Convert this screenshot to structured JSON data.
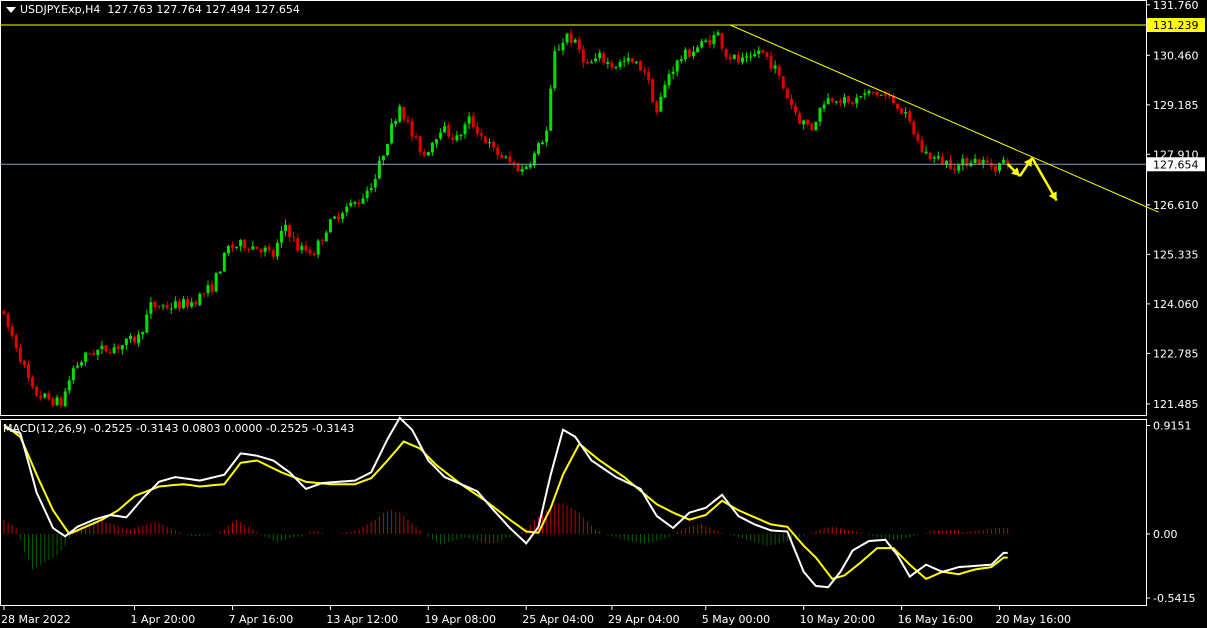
{
  "header": {
    "symbol": "USDJPY.Exp,H4",
    "open": "127.763",
    "high": "127.764",
    "low": "127.494",
    "close": "127.654"
  },
  "macd_header": {
    "name": "MACD(12,26,9)",
    "values": "-0.2525 -0.3143 0.0803 0.0000 -0.2525 -0.3143"
  },
  "colors": {
    "background": "#000000",
    "bull": "#00e000",
    "bear": "#e00000",
    "trendline": "#ffff00",
    "hline_yellow": "#ffff00",
    "hline_price": "#8a9bb8",
    "macd_line": "#ffffff",
    "signal_line": "#ffff00",
    "hist_pos": "#c00000",
    "hist_neg": "#006000",
    "arrow": "#ffff00",
    "label_yellow_bg": "#ffff00",
    "label_price_bg": "#ffffff"
  },
  "chart_data": [
    {
      "type": "candlestick",
      "title": "USDJPY.Exp,H4",
      "y_ticks": [
        "131.760",
        "130.460",
        "129.185",
        "127.910",
        "126.610",
        "125.335",
        "124.060",
        "122.785",
        "121.485"
      ],
      "ylim": [
        121.2,
        131.78
      ],
      "x_ticks": [
        "28 Mar 2022",
        "1 Apr 20:00",
        "7 Apr 16:00",
        "13 Apr 12:00",
        "19 Apr 08:00",
        "25 Apr 04:00",
        "29 Apr 04:00",
        "5 May 00:00",
        "10 May 20:00",
        "16 May 16:00",
        "20 May 16:00"
      ],
      "x_tick_index": [
        0,
        32,
        56,
        80,
        104,
        128,
        149,
        172,
        196,
        220,
        244
      ],
      "price_path": [
        [
          0,
          123.9
        ],
        [
          4,
          123.0
        ],
        [
          8,
          121.8
        ],
        [
          12,
          121.6
        ],
        [
          15,
          121.5
        ],
        [
          18,
          122.4
        ],
        [
          22,
          122.8
        ],
        [
          26,
          122.9
        ],
        [
          30,
          123.0
        ],
        [
          34,
          123.2
        ],
        [
          37,
          124.0
        ],
        [
          42,
          124.0
        ],
        [
          47,
          124.1
        ],
        [
          52,
          124.5
        ],
        [
          56,
          125.5
        ],
        [
          60,
          125.6
        ],
        [
          64,
          125.5
        ],
        [
          67,
          125.3
        ],
        [
          70,
          126.1
        ],
        [
          73,
          125.5
        ],
        [
          77,
          125.4
        ],
        [
          80,
          126.0
        ],
        [
          84,
          126.5
        ],
        [
          88,
          126.7
        ],
        [
          92,
          127.3
        ],
        [
          95,
          128.3
        ],
        [
          98,
          129.2
        ],
        [
          101,
          128.4
        ],
        [
          104,
          127.9
        ],
        [
          108,
          128.6
        ],
        [
          112,
          128.3
        ],
        [
          115,
          128.8
        ],
        [
          118,
          128.4
        ],
        [
          121,
          128.0
        ],
        [
          125,
          127.7
        ],
        [
          128,
          127.5
        ],
        [
          131,
          127.9
        ],
        [
          134,
          128.5
        ],
        [
          136,
          130.5
        ],
        [
          139,
          131.0
        ],
        [
          142,
          130.6
        ],
        [
          144,
          130.2
        ],
        [
          147,
          130.4
        ],
        [
          150,
          130.2
        ],
        [
          154,
          130.3
        ],
        [
          158,
          130.1
        ],
        [
          161,
          129.0
        ],
        [
          164,
          130.0
        ],
        [
          167,
          130.4
        ],
        [
          170,
          130.6
        ],
        [
          173,
          130.8
        ],
        [
          176,
          131.0
        ],
        [
          178,
          130.5
        ],
        [
          181,
          130.3
        ],
        [
          184,
          130.3
        ],
        [
          186,
          130.6
        ],
        [
          188,
          130.4
        ],
        [
          190,
          130.1
        ],
        [
          193,
          129.4
        ],
        [
          196,
          128.8
        ],
        [
          199,
          128.6
        ],
        [
          202,
          129.3
        ],
        [
          205,
          129.4
        ],
        [
          208,
          129.2
        ],
        [
          211,
          129.4
        ],
        [
          214,
          129.5
        ],
        [
          217,
          129.4
        ],
        [
          220,
          129.2
        ],
        [
          223,
          128.7
        ],
        [
          226,
          128.0
        ],
        [
          229,
          127.8
        ],
        [
          232,
          127.7
        ],
        [
          235,
          127.6
        ],
        [
          238,
          127.8
        ],
        [
          241,
          127.7
        ],
        [
          244,
          127.6
        ],
        [
          246,
          127.7
        ]
      ],
      "yellow_hline": 131.239,
      "price_hline": 127.654,
      "trendline": {
        "from": [
          178,
          131.239
        ],
        "to": [
          283,
          126.42
        ]
      },
      "price_labels": {
        "yellow": "131.239",
        "current": "127.654"
      },
      "projection_arrows": [
        [
          246,
          127.66
        ],
        [
          249,
          127.35
        ],
        [
          252,
          127.82
        ],
        [
          258,
          126.72
        ]
      ]
    },
    {
      "type": "macd",
      "title": "MACD(12,26,9)",
      "y_ticks": [
        "0.9151",
        "0.00",
        "-0.5415"
      ],
      "ylim": [
        -0.6,
        0.97
      ],
      "macd_path": [
        [
          0,
          0.9
        ],
        [
          4,
          0.85
        ],
        [
          8,
          0.35
        ],
        [
          12,
          0.05
        ],
        [
          15,
          -0.02
        ],
        [
          18,
          0.06
        ],
        [
          22,
          0.12
        ],
        [
          26,
          0.16
        ],
        [
          30,
          0.14
        ],
        [
          34,
          0.3
        ],
        [
          38,
          0.44
        ],
        [
          42,
          0.48
        ],
        [
          48,
          0.45
        ],
        [
          54,
          0.5
        ],
        [
          58,
          0.68
        ],
        [
          62,
          0.66
        ],
        [
          66,
          0.62
        ],
        [
          70,
          0.52
        ],
        [
          74,
          0.38
        ],
        [
          78,
          0.43
        ],
        [
          82,
          0.44
        ],
        [
          86,
          0.45
        ],
        [
          90,
          0.52
        ],
        [
          94,
          0.8
        ],
        [
          97,
          0.98
        ],
        [
          100,
          0.88
        ],
        [
          104,
          0.62
        ],
        [
          108,
          0.48
        ],
        [
          112,
          0.42
        ],
        [
          116,
          0.36
        ],
        [
          120,
          0.2
        ],
        [
          124,
          0.05
        ],
        [
          128,
          -0.08
        ],
        [
          131,
          0.06
        ],
        [
          134,
          0.5
        ],
        [
          137,
          0.88
        ],
        [
          140,
          0.82
        ],
        [
          144,
          0.62
        ],
        [
          150,
          0.48
        ],
        [
          156,
          0.38
        ],
        [
          160,
          0.15
        ],
        [
          164,
          0.05
        ],
        [
          168,
          0.18
        ],
        [
          172,
          0.22
        ],
        [
          176,
          0.33
        ],
        [
          180,
          0.15
        ],
        [
          184,
          0.08
        ],
        [
          188,
          0.03
        ],
        [
          192,
          0.02
        ],
        [
          196,
          -0.32
        ],
        [
          199,
          -0.44
        ],
        [
          202,
          -0.45
        ],
        [
          205,
          -0.32
        ],
        [
          208,
          -0.14
        ],
        [
          212,
          -0.06
        ],
        [
          216,
          -0.05
        ],
        [
          219,
          -0.18
        ],
        [
          222,
          -0.36
        ],
        [
          226,
          -0.26
        ],
        [
          230,
          -0.32
        ],
        [
          234,
          -0.28
        ],
        [
          238,
          -0.27
        ],
        [
          242,
          -0.26
        ],
        [
          245,
          -0.16
        ]
      ],
      "signal_path": [
        [
          0,
          0.92
        ],
        [
          4,
          0.82
        ],
        [
          8,
          0.5
        ],
        [
          12,
          0.2
        ],
        [
          16,
          0.0
        ],
        [
          20,
          0.06
        ],
        [
          24,
          0.12
        ],
        [
          28,
          0.2
        ],
        [
          32,
          0.32
        ],
        [
          38,
          0.4
        ],
        [
          44,
          0.42
        ],
        [
          48,
          0.4
        ],
        [
          54,
          0.42
        ],
        [
          58,
          0.6
        ],
        [
          62,
          0.62
        ],
        [
          68,
          0.52
        ],
        [
          74,
          0.44
        ],
        [
          80,
          0.42
        ],
        [
          86,
          0.42
        ],
        [
          90,
          0.47
        ],
        [
          94,
          0.62
        ],
        [
          98,
          0.78
        ],
        [
          102,
          0.72
        ],
        [
          106,
          0.58
        ],
        [
          112,
          0.42
        ],
        [
          118,
          0.28
        ],
        [
          124,
          0.12
        ],
        [
          128,
          0.02
        ],
        [
          131,
          0.01
        ],
        [
          134,
          0.22
        ],
        [
          137,
          0.5
        ],
        [
          141,
          0.76
        ],
        [
          146,
          0.62
        ],
        [
          152,
          0.48
        ],
        [
          160,
          0.25
        ],
        [
          164,
          0.18
        ],
        [
          168,
          0.12
        ],
        [
          172,
          0.16
        ],
        [
          176,
          0.28
        ],
        [
          180,
          0.2
        ],
        [
          184,
          0.14
        ],
        [
          188,
          0.08
        ],
        [
          192,
          0.06
        ],
        [
          196,
          -0.1
        ],
        [
          199,
          -0.2
        ],
        [
          203,
          -0.38
        ],
        [
          206,
          -0.35
        ],
        [
          210,
          -0.24
        ],
        [
          214,
          -0.12
        ],
        [
          218,
          -0.12
        ],
        [
          222,
          -0.26
        ],
        [
          226,
          -0.38
        ],
        [
          230,
          -0.32
        ],
        [
          234,
          -0.34
        ],
        [
          238,
          -0.3
        ],
        [
          242,
          -0.28
        ],
        [
          245,
          -0.2
        ]
      ],
      "histogram_path": [
        [
          0,
          0.12
        ],
        [
          3,
          0.05
        ],
        [
          5,
          -0.15
        ],
        [
          7,
          -0.3
        ],
        [
          9,
          -0.26
        ],
        [
          11,
          -0.22
        ],
        [
          13,
          -0.18
        ],
        [
          15,
          -0.1
        ],
        [
          17,
          0.02
        ],
        [
          19,
          0.06
        ],
        [
          21,
          0.1
        ],
        [
          23,
          0.12
        ],
        [
          25,
          0.1
        ],
        [
          27,
          0.08
        ],
        [
          29,
          0.05
        ],
        [
          31,
          0.04
        ],
        [
          33,
          0.06
        ],
        [
          35,
          0.08
        ],
        [
          37,
          0.1
        ],
        [
          38,
          0.09
        ],
        [
          40,
          0.06
        ],
        [
          42,
          0.03
        ],
        [
          44,
          0.0
        ],
        [
          46,
          -0.02
        ],
        [
          48,
          -0.02
        ],
        [
          50,
          -0.01
        ],
        [
          52,
          0.0
        ],
        [
          54,
          0.04
        ],
        [
          56,
          0.1
        ],
        [
          57,
          0.12
        ],
        [
          59,
          0.08
        ],
        [
          61,
          0.04
        ],
        [
          63,
          -0.01
        ],
        [
          65,
          -0.04
        ],
        [
          67,
          -0.07
        ],
        [
          69,
          -0.05
        ],
        [
          71,
          -0.03
        ],
        [
          73,
          -0.02
        ],
        [
          75,
          0.02
        ],
        [
          77,
          0.02
        ],
        [
          79,
          0.0
        ],
        [
          81,
          0.0
        ],
        [
          83,
          0.01
        ],
        [
          85,
          0.02
        ],
        [
          87,
          0.04
        ],
        [
          89,
          0.08
        ],
        [
          91,
          0.12
        ],
        [
          93,
          0.18
        ],
        [
          95,
          0.2
        ],
        [
          97,
          0.18
        ],
        [
          99,
          0.12
        ],
        [
          101,
          0.06
        ],
        [
          103,
          0.0
        ],
        [
          105,
          -0.05
        ],
        [
          107,
          -0.09
        ],
        [
          109,
          -0.07
        ],
        [
          111,
          -0.05
        ],
        [
          113,
          -0.03
        ],
        [
          115,
          -0.05
        ],
        [
          117,
          -0.07
        ],
        [
          119,
          -0.08
        ],
        [
          121,
          -0.07
        ],
        [
          123,
          -0.04
        ],
        [
          125,
          -0.02
        ],
        [
          127,
          0.02
        ],
        [
          129,
          0.08
        ],
        [
          131,
          0.14
        ],
        [
          133,
          0.2
        ],
        [
          135,
          0.25
        ],
        [
          137,
          0.26
        ],
        [
          139,
          0.22
        ],
        [
          141,
          0.18
        ],
        [
          143,
          0.1
        ],
        [
          145,
          0.04
        ],
        [
          147,
          0.0
        ],
        [
          149,
          -0.02
        ],
        [
          151,
          -0.04
        ],
        [
          153,
          -0.06
        ],
        [
          155,
          -0.07
        ],
        [
          157,
          -0.08
        ],
        [
          159,
          -0.07
        ],
        [
          161,
          -0.05
        ],
        [
          163,
          -0.03
        ],
        [
          165,
          0.02
        ],
        [
          167,
          0.05
        ],
        [
          169,
          0.07
        ],
        [
          171,
          0.08
        ],
        [
          173,
          0.05
        ],
        [
          175,
          0.02
        ],
        [
          177,
          0.0
        ],
        [
          179,
          -0.02
        ],
        [
          181,
          -0.04
        ],
        [
          183,
          -0.06
        ],
        [
          185,
          -0.08
        ],
        [
          187,
          -0.1
        ],
        [
          189,
          -0.09
        ],
        [
          191,
          -0.07
        ],
        [
          193,
          -0.05
        ],
        [
          195,
          -0.03
        ],
        [
          197,
          0.0
        ],
        [
          199,
          0.02
        ],
        [
          201,
          0.05
        ],
        [
          203,
          0.06
        ],
        [
          205,
          0.05
        ],
        [
          207,
          0.03
        ],
        [
          209,
          0.02
        ],
        [
          211,
          0.0
        ],
        [
          213,
          -0.02
        ],
        [
          215,
          -0.04
        ],
        [
          217,
          -0.05
        ],
        [
          219,
          -0.05
        ],
        [
          221,
          -0.04
        ],
        [
          223,
          -0.02
        ],
        [
          225,
          0.0
        ],
        [
          227,
          0.02
        ],
        [
          229,
          0.03
        ],
        [
          231,
          0.02
        ],
        [
          233,
          0.03
        ],
        [
          235,
          0.02
        ],
        [
          237,
          0.02
        ],
        [
          239,
          0.03
        ],
        [
          241,
          0.04
        ],
        [
          243,
          0.05
        ],
        [
          245,
          0.05
        ]
      ]
    }
  ]
}
